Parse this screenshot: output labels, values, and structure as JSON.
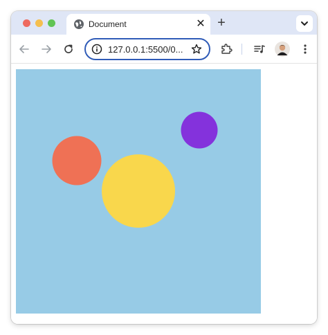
{
  "window": {
    "traffic_lights": [
      "close",
      "minimize",
      "maximize"
    ]
  },
  "tab": {
    "title": "Document",
    "favicon": "globe-icon",
    "close_icon": "close-icon"
  },
  "tabstrip": {
    "new_tab_icon": "plus-icon",
    "tab_search_icon": "chevron-down-icon"
  },
  "toolbar": {
    "back_icon": "arrow-left-icon",
    "forward_icon": "arrow-right-icon",
    "reload_icon": "reload-icon",
    "site_info_icon": "info-icon",
    "url": "127.0.0.1:5500/0...",
    "bookmark_icon": "star-icon",
    "extensions_icon": "puzzle-icon",
    "media_icon": "music-list-icon",
    "profile": "avatar",
    "menu_icon": "kebab-menu-icon"
  },
  "page": {
    "canvas_color": "#97cbe6",
    "circles": [
      {
        "name": "orange-circle",
        "color": "#ef7155"
      },
      {
        "name": "yellow-circle",
        "color": "#f9d74c"
      },
      {
        "name": "purple-circle",
        "color": "#8432dc"
      }
    ]
  }
}
